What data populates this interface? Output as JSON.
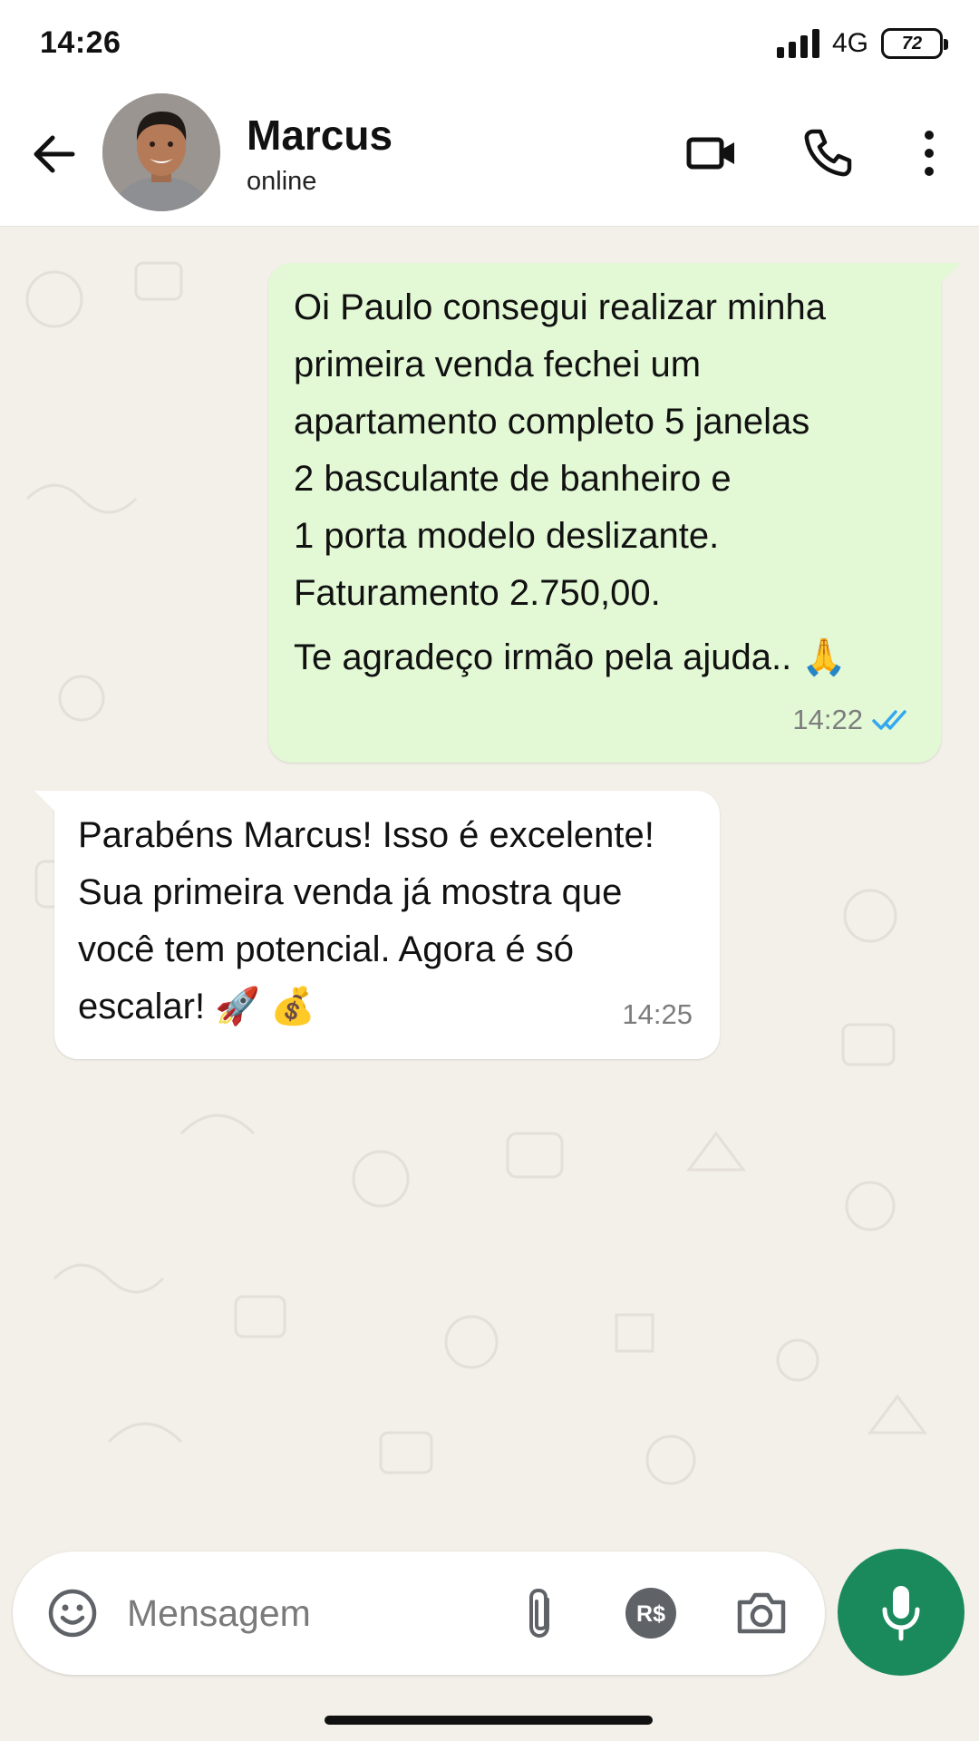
{
  "status_bar": {
    "time": "14:26",
    "network": "4G",
    "battery": "72"
  },
  "header": {
    "contact_name": "Marcus",
    "contact_status": "online",
    "icons": [
      "arrow-left-icon",
      "video-camera-icon",
      "phone-icon",
      "more-vertical-icon"
    ]
  },
  "messages": [
    {
      "direction": "outgoing",
      "lines": [
        "Oi Paulo consegui realizar minha",
        "primeira venda fechei um",
        "apartamento completo 5 janelas",
        "2 basculante de banheiro e",
        "1 porta modelo deslizante.",
        "Faturamento 2.750,00.",
        "Te agradeço irmão pela ajuda.. 🙏"
      ],
      "time": "14:22",
      "read": true
    },
    {
      "direction": "incoming",
      "lines": [
        "Parabéns Marcus! Isso é excelente!",
        "Sua primeira venda já mostra que",
        "você tem potencial. Agora é só",
        "escalar! 🚀 💰"
      ],
      "time": "14:25"
    }
  ],
  "composer": {
    "placeholder": "Mensagem",
    "payment_badge": "R$",
    "icons": [
      "emoji-icon",
      "paperclip-icon",
      "payment-icon",
      "camera-icon",
      "microphone-icon"
    ]
  },
  "colors": {
    "outgoing_bubble": "#e3f9d6",
    "incoming_bubble": "#ffffff",
    "chat_background": "#f3efe9",
    "read_ticks": "#34a7f0",
    "mic_button": "#1a8a5c"
  }
}
